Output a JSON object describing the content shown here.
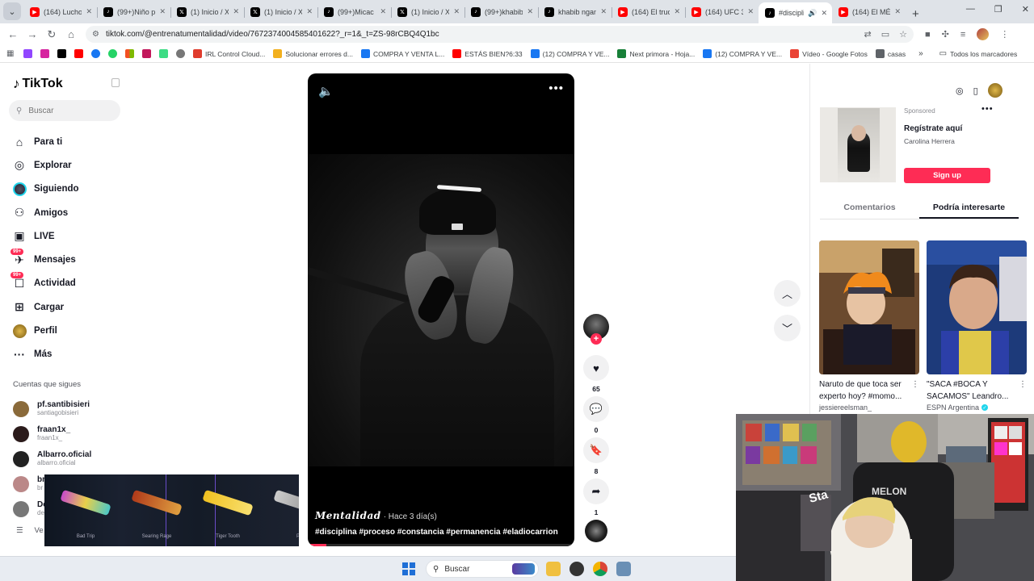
{
  "browser": {
    "tabs": [
      {
        "icon": "youtube",
        "title": "(164) Lucho"
      },
      {
        "icon": "tiktok",
        "title": "(99+)Niño p"
      },
      {
        "icon": "x",
        "title": "(1) Inicio / X"
      },
      {
        "icon": "x",
        "title": "(1) Inicio / X"
      },
      {
        "icon": "tiktok",
        "title": "(99+)Micac"
      },
      {
        "icon": "x",
        "title": "(1) Inicio / X"
      },
      {
        "icon": "tiktok",
        "title": "(99+)khabib"
      },
      {
        "icon": "tiktok",
        "title": "khabib ngan"
      },
      {
        "icon": "youtube",
        "title": "(164) El truc"
      },
      {
        "icon": "youtube",
        "title": "(164) UFC 3"
      },
      {
        "icon": "tiktok",
        "title": "#discipli",
        "active": true
      },
      {
        "icon": "youtube",
        "title": "(164) El MÉ"
      }
    ],
    "url": "tiktok.com/@entrenatumentalidad/video/7672374004585401622?_r=1&_t=ZS-98rCBQ4Q1bc",
    "bookmarks": [
      {
        "label": "IRL Control Cloud...",
        "color": "#e03c2d"
      },
      {
        "label": "Solucionar errores d...",
        "color": "#f2b01e"
      },
      {
        "label": "COMPRA Y VENTA L...",
        "color": "#1877f2"
      },
      {
        "label": "ESTÁS BIEN?6:33",
        "color": "#ff0000"
      },
      {
        "label": "(12) COMPRA Y VE...",
        "color": "#1877f2"
      },
      {
        "label": "Next primora - Hoja...",
        "color": "#188038"
      },
      {
        "label": "(12) COMPRA Y VE...",
        "color": "#1877f2"
      },
      {
        "label": "Vídeo - Google Fotos",
        "color": "#ea4335"
      },
      {
        "label": "casas",
        "color": "#5f6368"
      }
    ],
    "all_bookmarks": "Todos los marcadores",
    "more_bookmarks": "»"
  },
  "sidebar": {
    "logo": "TikTok",
    "search_placeholder": "Buscar",
    "menu": [
      {
        "label": "Para ti",
        "icon": "home-icon"
      },
      {
        "label": "Explorar",
        "icon": "compass-icon"
      },
      {
        "label": "Siguiendo",
        "icon": "following-avatar-icon"
      },
      {
        "label": "Amigos",
        "icon": "friends-icon"
      },
      {
        "label": "LIVE",
        "icon": "live-icon"
      },
      {
        "label": "Mensajes",
        "icon": "messages-icon",
        "badge": "99+"
      },
      {
        "label": "Actividad",
        "icon": "activity-icon",
        "badge": "99+"
      },
      {
        "label": "Cargar",
        "icon": "upload-icon"
      },
      {
        "label": "Perfil",
        "icon": "profile-avatar-icon"
      },
      {
        "label": "Más",
        "icon": "more-dots-icon"
      }
    ],
    "following_heading": "Cuentas que sigues",
    "following": [
      {
        "name": "pf.santibisieri",
        "handle": "santiagobisieri",
        "color": "#8a6a3a"
      },
      {
        "name": "fraan1x_",
        "handle": "fraan1x_",
        "color": "#2b1b1b"
      },
      {
        "name": "Albarro.oficial",
        "handle": "albarro.oficial",
        "color": "#222"
      },
      {
        "name": "br",
        "handle": "br",
        "color": "#b88"
      },
      {
        "name": "De",
        "handle": "de",
        "color": "#777"
      }
    ],
    "see_more": "Ve"
  },
  "overlay_skins": [
    {
      "label": "Bad Trip"
    },
    {
      "label": "Searing Rage"
    },
    {
      "label": "Tiger Tooth"
    },
    {
      "label": "Pr"
    }
  ],
  "video": {
    "author_display": "Mentalidad",
    "time_ago": "· Hace 3 día(s)",
    "hashtags": "#disciplina #proceso #constancia #permanencia #eladiocarrion",
    "progress": 0.07,
    "likes": "65",
    "comments": "0",
    "saves": "8",
    "shares": "1"
  },
  "right": {
    "ad": {
      "sponsored": "Sponsored",
      "title": "Regístrate aquí",
      "brand": "Carolina Herrera",
      "cta": "Sign up"
    },
    "tabs": [
      {
        "label": "Comentarios",
        "active": false
      },
      {
        "label": "Podría interesarte",
        "active": true
      }
    ],
    "recommendations": [
      {
        "title": "Naruto de que toca ser experto hoy? #momo...",
        "author": "jessiereelsman_",
        "verified": false
      },
      {
        "title": "\"SACA #BOCA Y SACAMOS\" Leandro...",
        "author": "ESPN Argentina",
        "verified": true
      }
    ]
  },
  "taskbar": {
    "search_placeholder": "Buscar"
  }
}
